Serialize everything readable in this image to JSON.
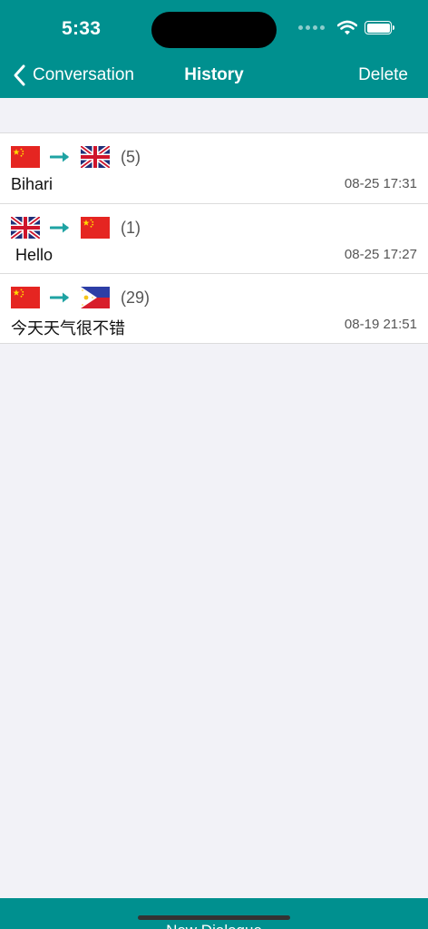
{
  "status_bar": {
    "time": "5:33"
  },
  "nav": {
    "back_label": "Conversation",
    "title": "History",
    "delete_label": "Delete"
  },
  "colors": {
    "accent": "#00908F",
    "arrow": "#1FA3A3",
    "background": "#F2F2F7"
  },
  "history": [
    {
      "from_flag": "china-flag-icon",
      "to_flag": "uk-flag-icon",
      "count": "(5)",
      "text": "Bihari",
      "date": "08-25 17:31"
    },
    {
      "from_flag": "uk-flag-icon",
      "to_flag": "china-flag-icon",
      "count": "(1)",
      "text": " Hello",
      "date": "08-25 17:27"
    },
    {
      "from_flag": "china-flag-icon",
      "to_flag": "philippines-flag-icon",
      "count": "(29)",
      "text": "今天天气很不错",
      "date": "08-19 21:51"
    }
  ],
  "bottom": {
    "new_dialogue_label": "New Dialogue"
  }
}
